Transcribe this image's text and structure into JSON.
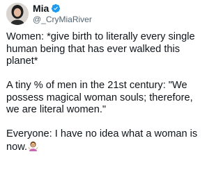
{
  "author": {
    "display_name": "Mia",
    "handle": "@_CryMiaRiver",
    "avatar_icon": "profile-photo-avatar",
    "verified_icon": "verified-badge-icon",
    "verified_color": "#1d9bf0"
  },
  "tweet": {
    "paragraphs": [
      "Women: *give birth to literally every single\nhuman being that has ever walked this\nplanet*",
      "A tiny % of men in the 21st century: \"We\npossess magical woman souls; therefore,\nwe are literal women.\"",
      "Everyone: I have no idea what a woman is\nnow."
    ],
    "trailing_emoji": "person-shrugging-emoji"
  }
}
